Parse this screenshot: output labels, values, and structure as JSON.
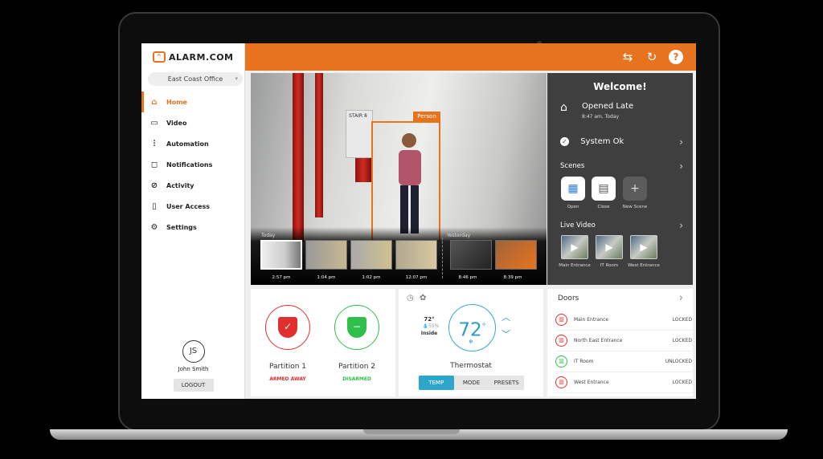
{
  "app": {
    "logo": "ALARM.COM",
    "location": "East Coast Office"
  },
  "sidebar": {
    "items": [
      {
        "label": "Home",
        "icon": "home-icon",
        "active": true
      },
      {
        "label": "Video",
        "icon": "video-icon"
      },
      {
        "label": "Automation",
        "icon": "sliders-icon"
      },
      {
        "label": "Notifications",
        "icon": "notification-icon"
      },
      {
        "label": "Activity",
        "icon": "activity-icon"
      },
      {
        "label": "User Access",
        "icon": "user-access-icon"
      },
      {
        "label": "Settings",
        "icon": "gear-icon"
      }
    ],
    "user": {
      "initials": "JS",
      "name": "John Smith",
      "logout": "LOGOUT"
    }
  },
  "header": {
    "icons": [
      "switch-icon",
      "refresh-icon",
      "help-icon"
    ]
  },
  "video": {
    "detection": "Person",
    "today": "Today",
    "yesterday": "Yesterday",
    "clips": [
      {
        "time": "2:57 pm"
      },
      {
        "time": "1:04 pm"
      },
      {
        "time": "1:02 pm"
      },
      {
        "time": "12:07 pm"
      },
      {
        "time": "8:46 pm"
      },
      {
        "time": "8:39 pm"
      }
    ],
    "sign": "STAIR 8"
  },
  "welcome": {
    "title": "Welcome!",
    "event": "Opened Late",
    "event_time": "8:47 am, Today",
    "status": "System Ok",
    "scenes_label": "Scenes",
    "scenes": [
      {
        "label": "Open"
      },
      {
        "label": "Close"
      },
      {
        "label": "New Scene"
      }
    ],
    "live_label": "Live Video",
    "live": [
      {
        "label": "Main Entrance"
      },
      {
        "label": "IT Room"
      },
      {
        "label": "West Entrance"
      }
    ]
  },
  "partitions": [
    {
      "name": "Partition 1",
      "status": "ARMED AWAY",
      "color": "#e0302e"
    },
    {
      "name": "Partition 2",
      "status": "DISARMED",
      "color": "#2fbf4a"
    }
  ],
  "thermostat": {
    "title": "Thermostat",
    "setpoint": "72",
    "inside_temp": "72°",
    "humidity": "55%",
    "inside_label": "Inside",
    "tabs": [
      "TEMP",
      "MODE",
      "PRESETS"
    ],
    "active_tab": "TEMP"
  },
  "doors": {
    "title": "Doors",
    "items": [
      {
        "name": "Main Entrance",
        "status": "LOCKED"
      },
      {
        "name": "North East Entrance",
        "status": "LOCKED"
      },
      {
        "name": "IT Room",
        "status": "UNLOCKED"
      },
      {
        "name": "West Entrance",
        "status": "LOCKED"
      }
    ]
  },
  "colors": {
    "accent": "#e8731e",
    "panel": "#3f3f3f",
    "thermo": "#2ea6cc"
  }
}
